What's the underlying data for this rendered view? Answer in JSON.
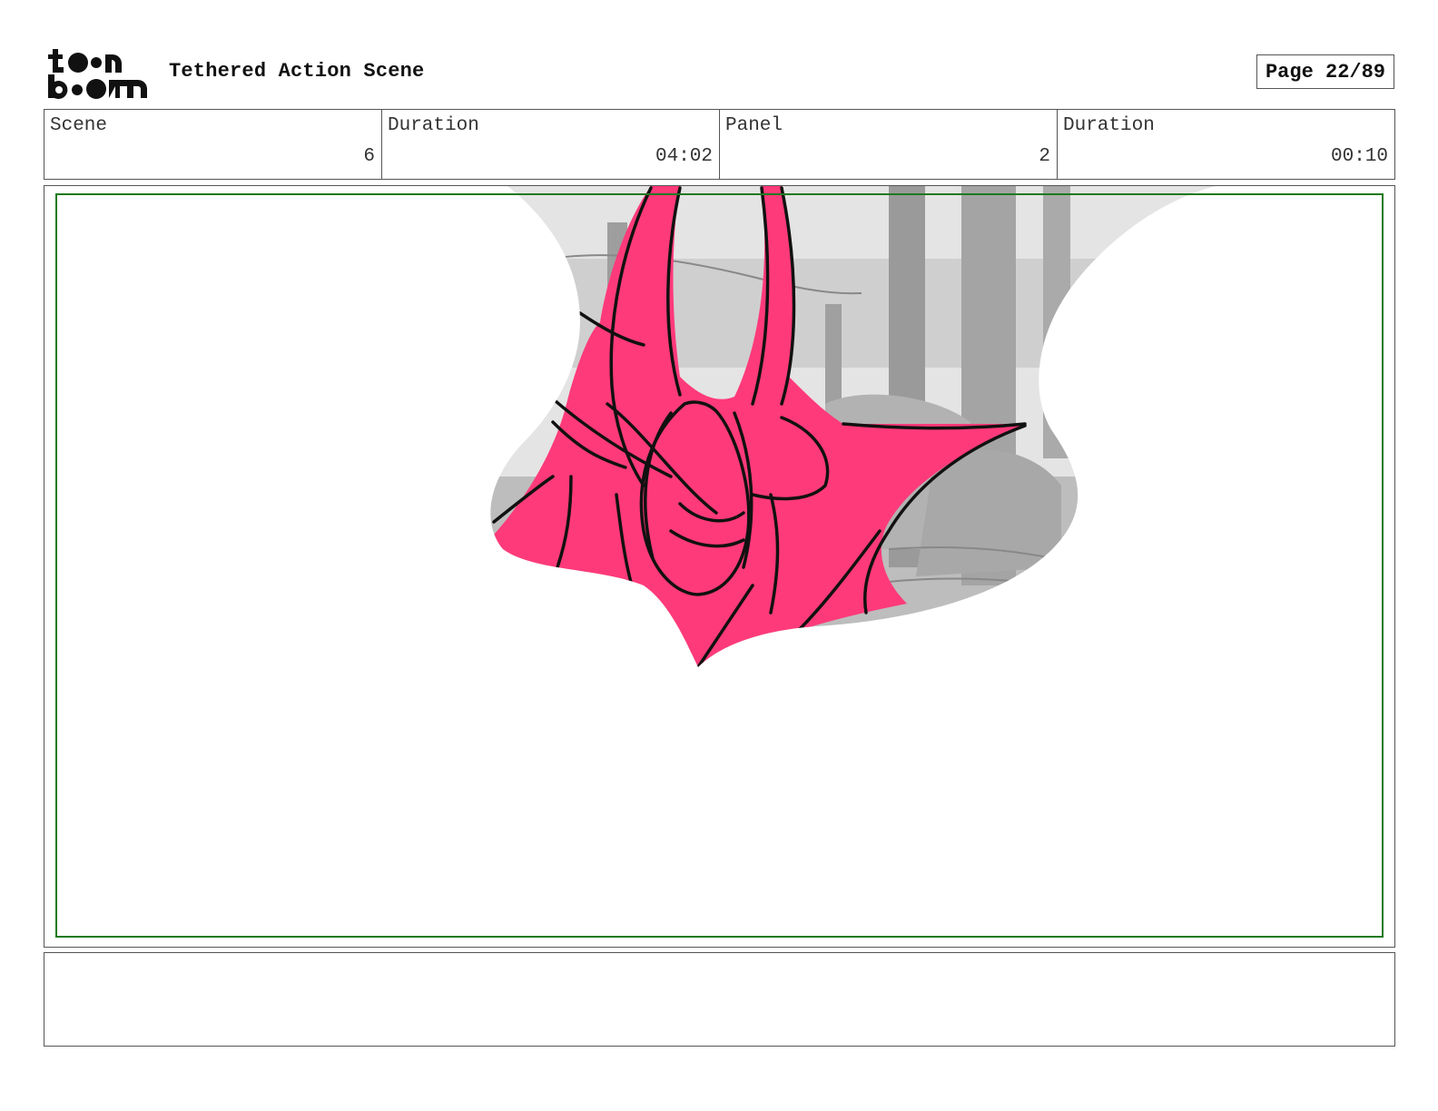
{
  "header": {
    "logo": {
      "line1": "toon",
      "line2": "boom"
    },
    "title": "Tethered Action Scene",
    "page_label": "Page 22/89"
  },
  "info": [
    {
      "label": "Scene",
      "value": "6"
    },
    {
      "label": "Duration",
      "value": "04:02"
    },
    {
      "label": "Panel",
      "value": "2"
    },
    {
      "label": "Duration",
      "value": "00:10"
    }
  ],
  "panel": {
    "colors": {
      "character": "#ff3a7a",
      "outline": "#111111",
      "safe_frame": "#1e7a1e",
      "background_gray": "#d6d6d6"
    }
  },
  "notes": {
    "text": ""
  }
}
